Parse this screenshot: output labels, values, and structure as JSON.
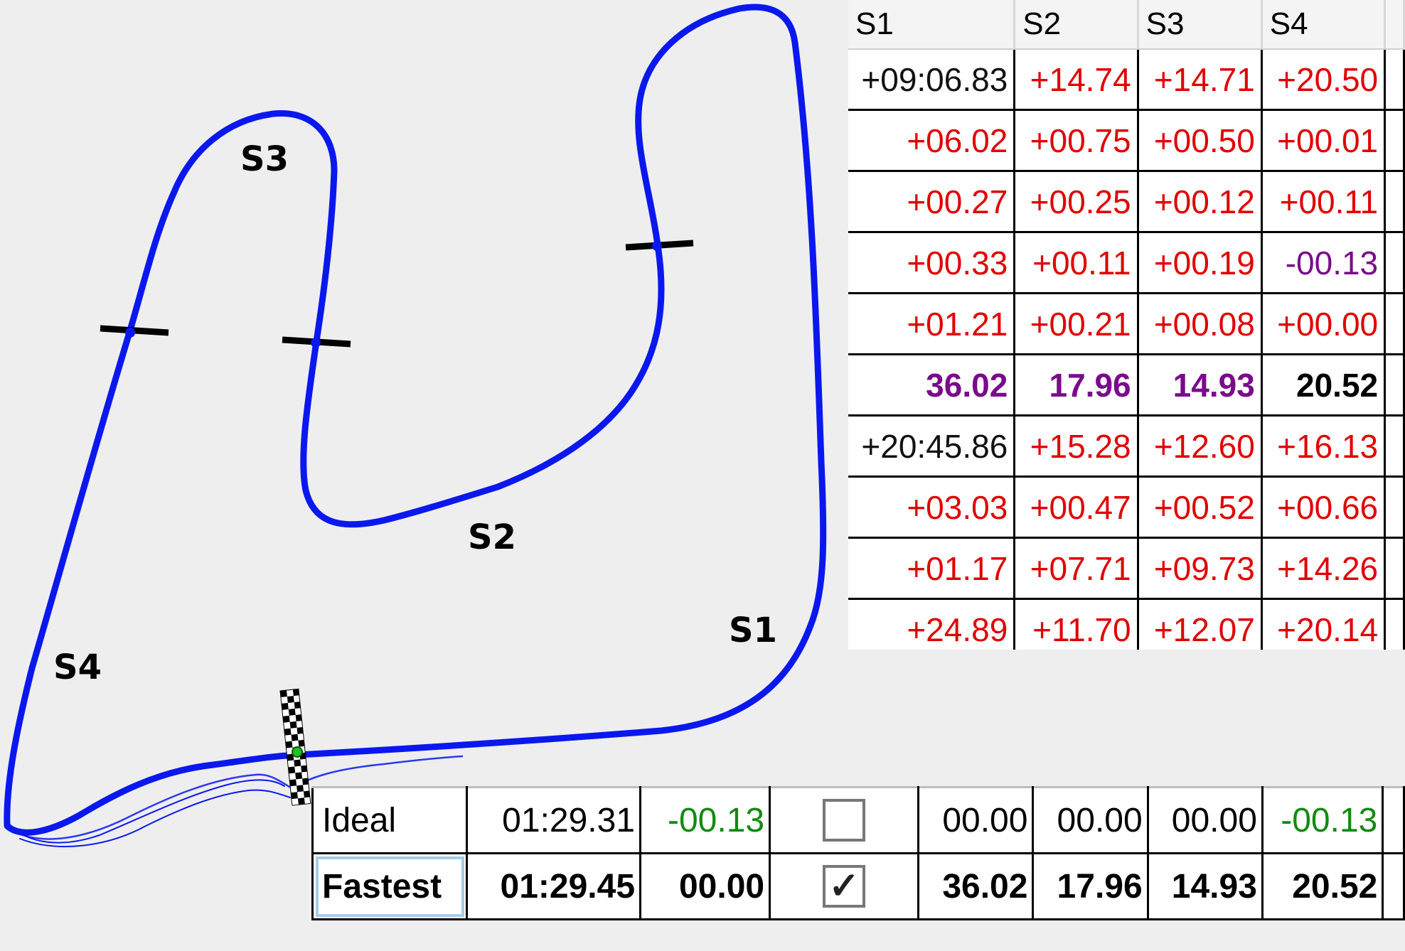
{
  "map": {
    "sector_labels": [
      "S1",
      "S2",
      "S3",
      "S4"
    ],
    "colors": {
      "track": "#0a18ee",
      "markers": "#000000"
    }
  },
  "sector_table": {
    "headers": [
      "S1",
      "S2",
      "S3",
      "S4"
    ],
    "rows": [
      [
        "+09:06.83",
        "+14.74",
        "+14.71",
        "+20.50"
      ],
      [
        "+06.02",
        "+00.75",
        "+00.50",
        "+00.01"
      ],
      [
        "+00.27",
        "+00.25",
        "+00.12",
        "+00.11"
      ],
      [
        "+00.33",
        "+00.11",
        "+00.19",
        "-00.13"
      ],
      [
        "+01.21",
        "+00.21",
        "+00.08",
        "+00.00"
      ],
      [
        "36.02",
        "17.96",
        "14.93",
        "20.52"
      ],
      [
        "+20:45.86",
        "+15.28",
        "+12.60",
        "+16.13"
      ],
      [
        "+03.03",
        "+00.47",
        "+00.52",
        "+00.66"
      ],
      [
        "+01.17",
        "+07.71",
        "+09.73",
        "+14.26"
      ],
      [
        "+24.89",
        "+11.70",
        "+12.07",
        "+20.14"
      ]
    ],
    "colors": {
      "slower": "#e00000",
      "best": "#7a0a8c",
      "neutral": "#111111"
    }
  },
  "summary_table": {
    "rows": [
      {
        "name": "Ideal",
        "time": "01:29.31",
        "delta": "-00.13",
        "checked": false,
        "sectors": [
          "00.00",
          "00.00",
          "00.00",
          "-00.13"
        ]
      },
      {
        "name": "Fastest",
        "time": "01:29.45",
        "delta": "00.00",
        "checked": true,
        "sectors": [
          "36.02",
          "17.96",
          "14.93",
          "20.52"
        ]
      }
    ],
    "check_glyph": "✓"
  }
}
